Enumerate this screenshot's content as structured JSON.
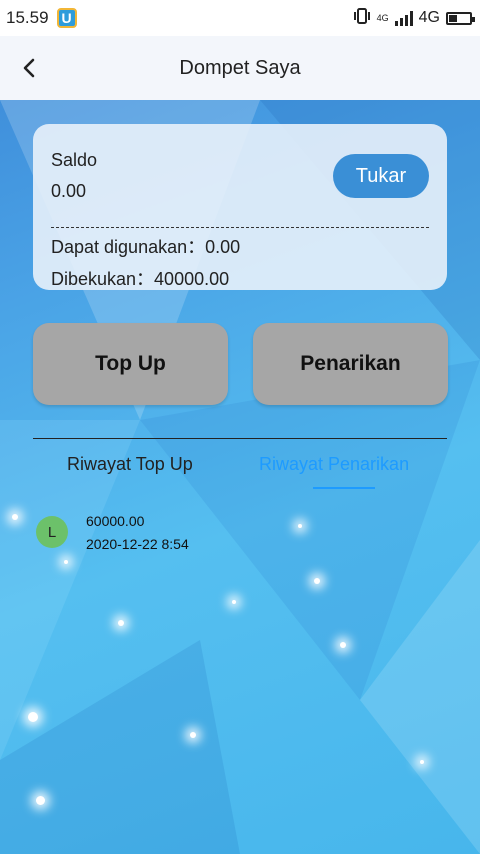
{
  "status": {
    "time": "15.59",
    "app_icon_letter": "U",
    "network_small": "4G",
    "network": "4G"
  },
  "header": {
    "title": "Dompet Saya",
    "back_icon": "chevron-left-icon"
  },
  "wallet": {
    "saldo_label": "Saldo",
    "saldo_value": "0.00",
    "exchange_label": "Tukar",
    "available_text": "Dapat digunakan：0.00",
    "frozen_text": "Dibekukan：40000.00"
  },
  "actions": {
    "topup_label": "Top Up",
    "withdraw_label": "Penarikan"
  },
  "tabs": [
    {
      "label": "Riwayat Top Up",
      "active": false
    },
    {
      "label": "Riwayat Penarikan",
      "active": true
    }
  ],
  "history": [
    {
      "badge": "L",
      "amount": "60000.00",
      "date": "2020-12-22 8:54"
    }
  ],
  "colors": {
    "accent": "#1e9bff",
    "exchange_button": "#3a8fd6",
    "action_button": "#a6a6a6",
    "badge": "#6cc16a"
  }
}
